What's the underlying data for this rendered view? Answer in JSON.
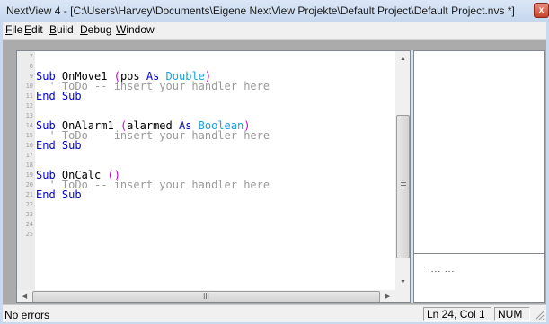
{
  "window": {
    "title": "NextView 4 - [C:\\Users\\Harvey\\Documents\\Eigene NextView Projekte\\Default Project\\Default Project.nvs *]",
    "close_glyph": "x"
  },
  "menu": {
    "items": [
      {
        "accel": "F",
        "rest": "ile"
      },
      {
        "accel": "E",
        "rest": "dit"
      },
      {
        "accel": "B",
        "rest": "uild"
      },
      {
        "accel": "D",
        "rest": "ebug"
      },
      {
        "accel": "W",
        "rest": "indow"
      }
    ]
  },
  "editor": {
    "lines": [
      {
        "num": "7",
        "parts": []
      },
      {
        "num": "8",
        "parts": []
      },
      {
        "num": "9",
        "parts": [
          {
            "t": "Sub",
            "c": "kw"
          },
          {
            "t": " OnMove1 ",
            "c": ""
          },
          {
            "t": "(",
            "c": "paren"
          },
          {
            "t": "pos ",
            "c": ""
          },
          {
            "t": "As",
            "c": "kw"
          },
          {
            "t": " ",
            "c": ""
          },
          {
            "t": "Double",
            "c": "type"
          },
          {
            "t": ")",
            "c": "paren"
          }
        ]
      },
      {
        "num": "10",
        "parts": [
          {
            "t": "  ' ToDo -- insert your handler here",
            "c": "cm"
          }
        ]
      },
      {
        "num": "11",
        "parts": [
          {
            "t": "End",
            "c": "kw"
          },
          {
            "t": " ",
            "c": ""
          },
          {
            "t": "Sub",
            "c": "kw"
          }
        ]
      },
      {
        "num": "12",
        "parts": []
      },
      {
        "num": "13",
        "parts": []
      },
      {
        "num": "14",
        "parts": [
          {
            "t": "Sub",
            "c": "kw"
          },
          {
            "t": " OnAlarm1 ",
            "c": ""
          },
          {
            "t": "(",
            "c": "paren"
          },
          {
            "t": "alarmed ",
            "c": ""
          },
          {
            "t": "As",
            "c": "kw"
          },
          {
            "t": " ",
            "c": ""
          },
          {
            "t": "Boolean",
            "c": "type"
          },
          {
            "t": ")",
            "c": "paren"
          }
        ]
      },
      {
        "num": "15",
        "parts": [
          {
            "t": "  ' ToDo -- insert your handler here",
            "c": "cm"
          }
        ]
      },
      {
        "num": "16",
        "parts": [
          {
            "t": "End",
            "c": "kw"
          },
          {
            "t": " ",
            "c": ""
          },
          {
            "t": "Sub",
            "c": "kw"
          }
        ]
      },
      {
        "num": "17",
        "parts": []
      },
      {
        "num": "18",
        "parts": []
      },
      {
        "num": "19",
        "parts": [
          {
            "t": "Sub",
            "c": "kw"
          },
          {
            "t": " OnCalc ",
            "c": ""
          },
          {
            "t": "()",
            "c": "paren"
          }
        ]
      },
      {
        "num": "20",
        "parts": [
          {
            "t": "  ' ToDo -- insert your handler here",
            "c": "cm"
          }
        ]
      },
      {
        "num": "21",
        "parts": [
          {
            "t": "End",
            "c": "kw"
          },
          {
            "t": " ",
            "c": ""
          },
          {
            "t": "Sub",
            "c": "kw"
          }
        ]
      },
      {
        "num": "22",
        "parts": []
      },
      {
        "num": "23",
        "parts": []
      },
      {
        "num": "24",
        "parts": []
      },
      {
        "num": "25",
        "parts": []
      }
    ],
    "hscroll_thumb_glyph": "III",
    "vscroll_thumb_glyph": "≡"
  },
  "side_panel": {
    "tree_text": ".... ..."
  },
  "status": {
    "message": "No errors",
    "position": "Ln 24, Col 1",
    "num": "NUM"
  },
  "colors": {
    "keyword": "#0000cd",
    "paren": "#c800c8",
    "type": "#1ba1e2",
    "comment": "#9a9a9a"
  }
}
